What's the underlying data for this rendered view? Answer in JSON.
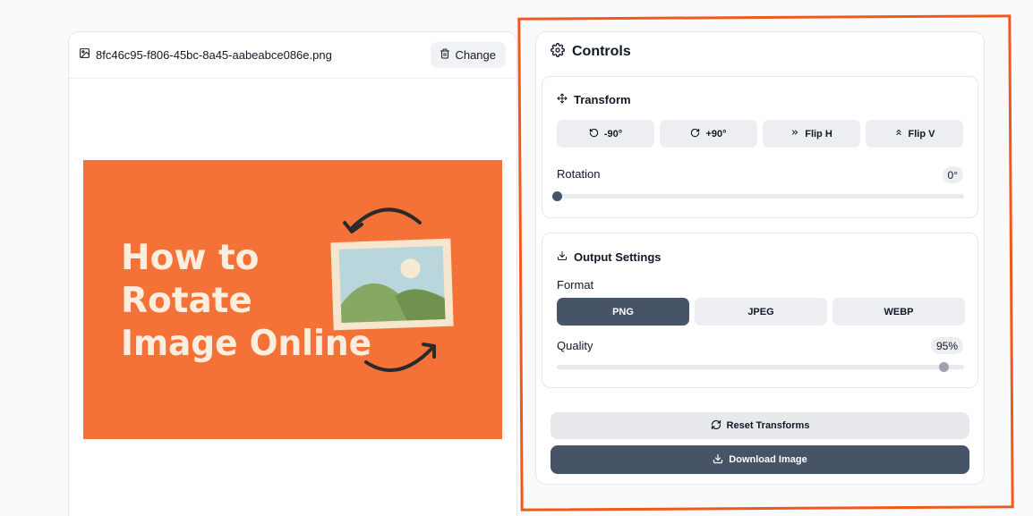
{
  "preview": {
    "file_name": "8fc46c95-f806-45bc-8a45-aabeabce086e.png",
    "change_label": "Change",
    "image_text": [
      "How to",
      "Rotate",
      "Image Online"
    ]
  },
  "controls": {
    "title": "Controls",
    "transform": {
      "title": "Transform",
      "buttons": {
        "rotate_left": "-90°",
        "rotate_right": "+90°",
        "flip_h": "Flip H",
        "flip_v": "Flip V"
      },
      "rotation_label": "Rotation",
      "rotation_value": "0°",
      "rotation_fraction": 0.0
    },
    "output": {
      "title": "Output Settings",
      "format_label": "Format",
      "formats": [
        "PNG",
        "JPEG",
        "WEBP"
      ],
      "selected_format": "PNG",
      "quality_label": "Quality",
      "quality_value": "95%",
      "quality_fraction": 0.95
    },
    "reset_label": "Reset Transforms",
    "download_label": "Download Image"
  },
  "colors": {
    "accent_highlight": "#f0581d",
    "image_background": "#f47237",
    "primary_button": "#475366"
  }
}
